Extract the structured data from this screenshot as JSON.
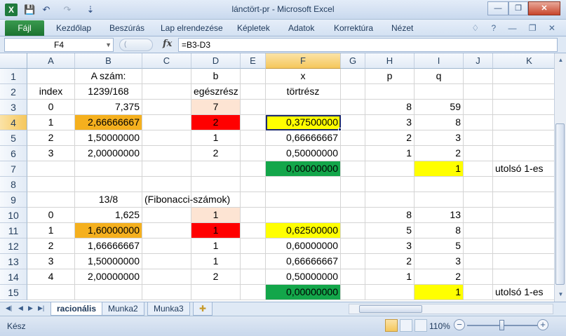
{
  "window": {
    "title": "lánctört-pr  -  Microsoft Excel",
    "app_icon_letter": "X",
    "minimize_glyph": "—",
    "restore_glyph": "❐",
    "close_glyph": "✕"
  },
  "quick_access": {
    "save_glyph": "💾",
    "undo_glyph": "↶",
    "redo_glyph": "↷",
    "customize_glyph": "⇣"
  },
  "ribbon": {
    "file_tab": "Fájl",
    "tabs": [
      "Kezdőlap",
      "Beszúrás",
      "Lap elrendezése",
      "Képletek",
      "Adatok",
      "Korrektúra",
      "Nézet"
    ],
    "icons": "♢ ? — ❐ ✕"
  },
  "formula_bar": {
    "name_box": "F4",
    "fx_label": "fx",
    "formula": "=B3-D3"
  },
  "columns": [
    "A",
    "B",
    "C",
    "D",
    "E",
    "F",
    "G",
    "H",
    "I",
    "J",
    "K"
  ],
  "selected_column": "F",
  "selected_row": "4",
  "rows": [
    {
      "num": "1",
      "cells": {
        "B": "A szám:",
        "D": "b",
        "F": "x",
        "H": "p",
        "I": "q"
      }
    },
    {
      "num": "2",
      "cells": {
        "A": "index",
        "B": "1239/168",
        "D": "egészrész",
        "F": "törtrész"
      }
    },
    {
      "num": "3",
      "cells": {
        "A": "0",
        "B": "7,375",
        "D": "7",
        "H": "8",
        "I": "59"
      }
    },
    {
      "num": "4",
      "cells": {
        "A": "1",
        "B": "2,66666667",
        "D": "2",
        "F": "0,37500000",
        "H": "3",
        "I": "8"
      }
    },
    {
      "num": "5",
      "cells": {
        "A": "2",
        "B": "1,50000000",
        "D": "1",
        "F": "0,66666667",
        "H": "2",
        "I": "3"
      }
    },
    {
      "num": "6",
      "cells": {
        "A": "3",
        "B": "2,00000000",
        "D": "2",
        "F": "0,50000000",
        "H": "1",
        "I": "2"
      }
    },
    {
      "num": "7",
      "cells": {
        "F": "0,00000000",
        "I": "1",
        "K": "utolsó 1-es"
      }
    },
    {
      "num": "8",
      "cells": {}
    },
    {
      "num": "9",
      "cells": {
        "B": "13/8",
        "C": "(Fibonacci-számok)"
      }
    },
    {
      "num": "10",
      "cells": {
        "A": "0",
        "B": "1,625",
        "D": "1",
        "H": "8",
        "I": "13"
      }
    },
    {
      "num": "11",
      "cells": {
        "A": "1",
        "B": "1,60000000",
        "D": "1",
        "F": "0,62500000",
        "H": "5",
        "I": "8"
      }
    },
    {
      "num": "12",
      "cells": {
        "A": "2",
        "B": "1,66666667",
        "D": "1",
        "F": "0,60000000",
        "H": "3",
        "I": "5"
      }
    },
    {
      "num": "13",
      "cells": {
        "A": "3",
        "B": "1,50000000",
        "D": "1",
        "F": "0,66666667",
        "H": "2",
        "I": "3"
      }
    },
    {
      "num": "14",
      "cells": {
        "A": "4",
        "B": "2,00000000",
        "D": "2",
        "F": "0,50000000",
        "H": "1",
        "I": "2"
      }
    },
    {
      "num": "15",
      "cells": {
        "F": "0,00000000",
        "I": "1",
        "K": "utolsó 1-es"
      }
    }
  ],
  "fills": {
    "B4": "#f5b01e",
    "D3": "#fde4d3",
    "D4": "#ff0000",
    "F7": "#13a64a",
    "I7": "#ffff00",
    "B11": "#f5b01e",
    "D10": "#fde4d3",
    "D11": "#ff0000",
    "F11": "#ffff00",
    "F15": "#13a64a",
    "I15": "#ffff00",
    "F4": "#ffff00"
  },
  "sheets": {
    "tabs": [
      "racionális",
      "Munka2",
      "Munka3"
    ],
    "active": "racionális",
    "nav_glyphs": [
      "◀|",
      "◀",
      "▶",
      "▶|"
    ],
    "new_sheet_glyph": "✚"
  },
  "status": {
    "ready": "Kész",
    "zoom": "110%",
    "zoom_minus": "−",
    "zoom_plus": "+"
  }
}
